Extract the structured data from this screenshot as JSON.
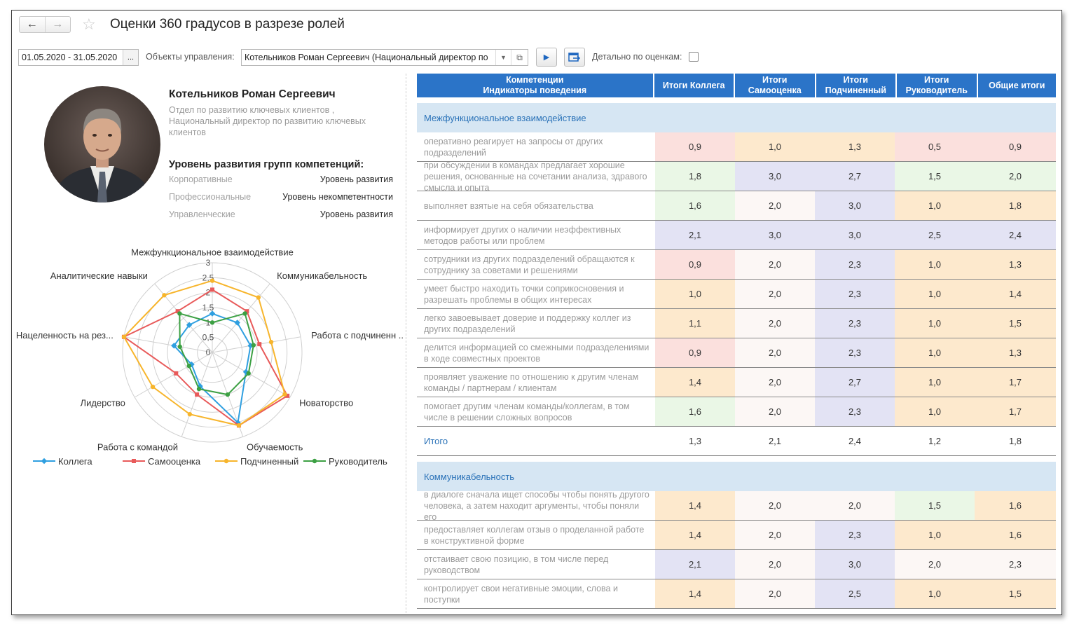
{
  "window": {
    "title": "Оценки 360 градусов в разрезе ролей",
    "back_icon": "arrow-left-icon",
    "forward_icon": "arrow-right-icon",
    "favorite_icon": "star-icon"
  },
  "toolbar": {
    "period": "01.05.2020 - 31.05.2020",
    "period_button": "...",
    "objects_label": "Объекты управления:",
    "objects_value": "Котельников Роман Сергеевич (Национальный директор по",
    "details_label": "Детально по оценкам:",
    "details_checked": false
  },
  "profile": {
    "name": "Котельников Роман Сергеевич",
    "position": "Отдел по развитию ключевых клиентов , Национальный директор по развитию ключевых клиентов",
    "levels_title": "Уровень развития групп компетенций:",
    "levels": [
      {
        "group": "Корпоративные",
        "level": "Уровень развития"
      },
      {
        "group": "Профессиональные",
        "level": "Уровень некомпетентности"
      },
      {
        "group": "Управленческие",
        "level": "Уровень развития"
      }
    ]
  },
  "chart_data": {
    "type": "radar",
    "axes": [
      "Межфункциональное взаимодействие",
      "Коммуникабельность",
      "Работа с подчиненн ...",
      "Новаторство",
      "Обучаемость",
      "Работа с командой",
      "Лидерство",
      "Нацеленность на рез...",
      "Аналитические навыки"
    ],
    "ticks": [
      "0",
      "0,5",
      "1",
      "1,5",
      "2",
      "2,5",
      "3"
    ],
    "rlim": [
      0,
      3
    ],
    "series": [
      {
        "name": "Коллега",
        "color": "#2f9fe0",
        "values": [
          1.3,
          1.3,
          1.3,
          1.3,
          2.5,
          1.2,
          0.8,
          1.3,
          1.2
        ]
      },
      {
        "name": "Самооценка",
        "color": "#e85a5a",
        "values": [
          2.1,
          1.8,
          1.6,
          2.9,
          2.6,
          1.5,
          1.4,
          3.0,
          1.8
        ]
      },
      {
        "name": "Подчиненный",
        "color": "#f7b52c",
        "values": [
          2.4,
          2.4,
          2.0,
          2.8,
          2.6,
          2.2,
          2.3,
          3.0,
          2.5
        ]
      },
      {
        "name": "Руководитель",
        "color": "#3ca043",
        "values": [
          1.0,
          1.7,
          1.4,
          1.4,
          1.5,
          1.3,
          0.9,
          1.1,
          1.7
        ]
      }
    ]
  },
  "table": {
    "headers": [
      "Компетенции\nИндикаторы поведения",
      "Итоги Коллега",
      "Итоги\nСамооценка",
      "Итоги\nПодчиненный",
      "Итоги\nРуководитель",
      "Общие итоги"
    ],
    "sections": [
      {
        "title": "Межфункциональное взаимодействие",
        "rows": [
          {
            "text": "оперативно реагирует на запросы от других подразделений",
            "values": [
              "0,9",
              "1,0",
              "1,3",
              "0,5",
              "0,9"
            ],
            "colors": [
              "red",
              "org",
              "org",
              "red",
              "red"
            ]
          },
          {
            "text": "при обсуждении в командах предлагает хорошие решения, основанные на сочетании анализа, здравого смысла и опыта",
            "values": [
              "1,8",
              "3,0",
              "2,7",
              "1,5",
              "2,0"
            ],
            "colors": [
              "grn",
              "blu",
              "blu",
              "grn",
              "grn"
            ]
          },
          {
            "text": "выполняет взятые на себя обязательства",
            "values": [
              "1,6",
              "2,0",
              "3,0",
              "1,0",
              "1,8"
            ],
            "colors": [
              "grn",
              "wht",
              "blu",
              "org",
              "org"
            ]
          },
          {
            "text": "информирует других о наличии неэффективных методов работы или проблем",
            "values": [
              "2,1",
              "3,0",
              "3,0",
              "2,5",
              "2,4"
            ],
            "colors": [
              "blu",
              "blu",
              "blu",
              "blu",
              "blu"
            ]
          },
          {
            "text": "сотрудники из других подразделений обращаются к сотруднику за советами и решениями",
            "values": [
              "0,9",
              "2,0",
              "2,3",
              "1,0",
              "1,3"
            ],
            "colors": [
              "red",
              "wht",
              "blu",
              "org",
              "org"
            ]
          },
          {
            "text": "умеет быстро находить точки соприкосновения и разрешать проблемы в общих интересах",
            "values": [
              "1,0",
              "2,0",
              "2,3",
              "1,0",
              "1,4"
            ],
            "colors": [
              "org",
              "wht",
              "blu",
              "org",
              "org"
            ]
          },
          {
            "text": "легко завоевывает доверие и поддержку коллег из других подразделений",
            "values": [
              "1,1",
              "2,0",
              "2,3",
              "1,0",
              "1,5"
            ],
            "colors": [
              "org",
              "wht",
              "blu",
              "org",
              "org"
            ]
          },
          {
            "text": "делится информацией со смежными подразделениями в ходе совместных проектов",
            "values": [
              "0,9",
              "2,0",
              "2,3",
              "1,0",
              "1,3"
            ],
            "colors": [
              "red",
              "wht",
              "blu",
              "org",
              "org"
            ]
          },
          {
            "text": "проявляет уважение по отношению к другим членам команды / партнерам / клиентам",
            "values": [
              "1,4",
              "2,0",
              "2,7",
              "1,0",
              "1,7"
            ],
            "colors": [
              "org",
              "wht",
              "blu",
              "org",
              "org"
            ]
          },
          {
            "text": "помогает другим членам команды/коллегам, в том числе в решении сложных вопросов",
            "values": [
              "1,6",
              "2,0",
              "2,3",
              "1,0",
              "1,7"
            ],
            "colors": [
              "grn",
              "wht",
              "blu",
              "org",
              "org"
            ]
          }
        ],
        "total": {
          "label": "Итого",
          "values": [
            "1,3",
            "2,1",
            "2,4",
            "1,2",
            "1,8"
          ]
        }
      },
      {
        "title": "Коммуникабельность",
        "rows": [
          {
            "text": "в диалоге сначала ищет способы чтобы понять другого человека, а затем находит аргументы, чтобы поняли его",
            "values": [
              "1,4",
              "2,0",
              "2,0",
              "1,5",
              "1,6"
            ],
            "colors": [
              "org",
              "wht",
              "wht",
              "grn",
              "org"
            ]
          },
          {
            "text": "предоставляет коллегам отзыв о проделанной работе в конструктивной форме",
            "values": [
              "1,4",
              "2,0",
              "2,3",
              "1,0",
              "1,6"
            ],
            "colors": [
              "org",
              "wht",
              "blu",
              "org",
              "org"
            ]
          },
          {
            "text": "отстаивает свою позицию, в том числе перед руководством",
            "values": [
              "2,1",
              "2,0",
              "3,0",
              "2,0",
              "2,3"
            ],
            "colors": [
              "blu",
              "wht",
              "blu",
              "wht",
              "wht"
            ]
          },
          {
            "text": "контролирует свои негативные эмоции, слова и поступки",
            "values": [
              "1,4",
              "2,0",
              "2,5",
              "1,0",
              "1,5"
            ],
            "colors": [
              "org",
              "wht",
              "blu",
              "org",
              "org"
            ]
          }
        ]
      }
    ]
  }
}
